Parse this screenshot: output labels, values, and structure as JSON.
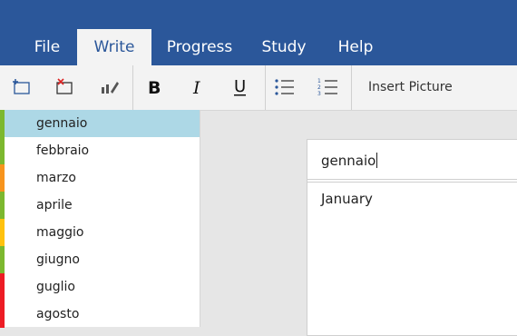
{
  "menu": {
    "tabs": [
      {
        "label": "File"
      },
      {
        "label": "Write",
        "active": true
      },
      {
        "label": "Progress"
      },
      {
        "label": "Study"
      },
      {
        "label": "Help"
      }
    ]
  },
  "toolbar": {
    "insert_picture_label": "Insert Picture",
    "icons": [
      "add-card-icon",
      "delete-card-icon",
      "edit-card-icon",
      "bold-icon",
      "italic-icon",
      "underline-icon",
      "bullet-list-icon",
      "numbered-list-icon"
    ]
  },
  "sidebar": {
    "items": [
      {
        "label": "gennaio",
        "color": "#7cb82f",
        "selected": true
      },
      {
        "label": "febbraio",
        "color": "#7cb82f"
      },
      {
        "label": "marzo",
        "color": "#f7941d"
      },
      {
        "label": "aprile",
        "color": "#7cb82f"
      },
      {
        "label": "maggio",
        "color": "#ffc20e"
      },
      {
        "label": "giugno",
        "color": "#7cb82f"
      },
      {
        "label": "guglio",
        "color": "#ed1c24"
      },
      {
        "label": "agosto",
        "color": "#ed1c24"
      }
    ]
  },
  "card": {
    "front": "gennaio",
    "back": "January"
  },
  "colors": {
    "accent": "#2b579a",
    "selected_row": "#add8e6"
  }
}
